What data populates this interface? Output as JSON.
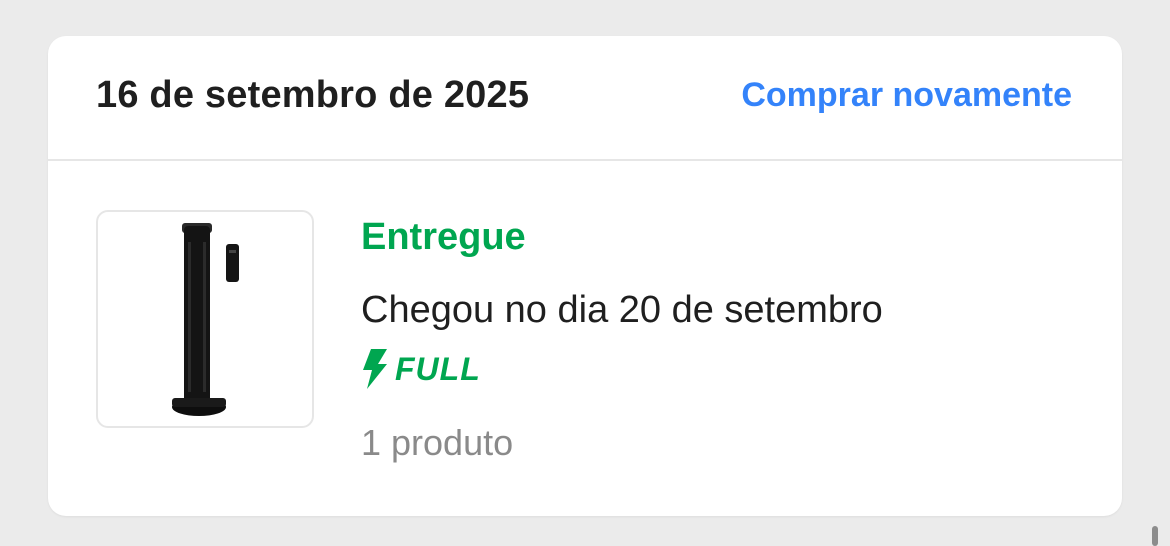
{
  "order": {
    "date": "16 de setembro de 2025",
    "buy_again_label": "Comprar novamente",
    "status": "Entregue",
    "arrival_text": "Chegou no dia 20 de setembro",
    "shipping_badge": {
      "icon": "lightning-bolt-icon",
      "label": "FULL",
      "color": "#00a650"
    },
    "product_count": "1 produto",
    "product_image": "tower-fan-with-remote"
  },
  "colors": {
    "accent_link": "#3483fa",
    "status_green": "#00a650",
    "text_primary": "#1f1f1f",
    "text_secondary": "#8a8a8a",
    "background": "#ebebeb"
  }
}
